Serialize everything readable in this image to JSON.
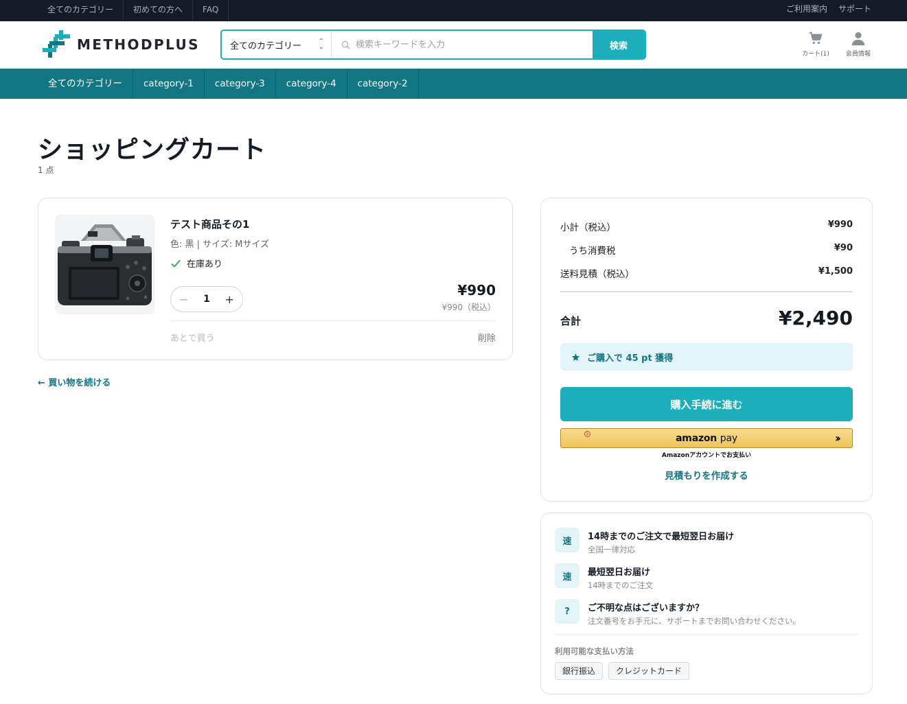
{
  "topbar": {
    "left_links": [
      "全てのカテゴリー",
      "初めての方へ",
      "FAQ"
    ],
    "right_links": [
      "ご利用案内",
      "サポート"
    ]
  },
  "header": {
    "logo_text": "METHODPLUS",
    "search": {
      "category_selected": "全てのカテゴリー",
      "placeholder": "検索キーワードを入力",
      "button_label": "検索"
    },
    "cart_label": "カート(1)",
    "account_label": "会員情報"
  },
  "category_nav": [
    "全てのカテゴリー",
    "category-1",
    "category-3",
    "category-4",
    "category-2"
  ],
  "page": {
    "title": "ショッピングカート",
    "count": "1 点"
  },
  "cart_item": {
    "name": "テスト商品その1",
    "options": "色: 黒 | サイズ: Mサイズ",
    "stock": "在庫あり",
    "quantity": "1",
    "price": "¥990",
    "price_tax": "¥990（税込）",
    "save_later": "あとで買う",
    "delete": "削除"
  },
  "continue_shopping": "← 買い物を続ける",
  "summary": {
    "subtotal_label": "小計（税込）",
    "subtotal_value": "¥990",
    "tax_label": "うち消費税",
    "tax_value": "¥90",
    "shipping_label": "送料見積（税込）",
    "shipping_value": "¥1,500",
    "total_label": "合計",
    "total_value": "¥2,490",
    "points": "ご購入で 45 pt 獲得",
    "checkout_label": "購入手続に進む",
    "amazon_logo": "amazon",
    "amazon_pay": "pay",
    "amazon_sub": "Amazonアカウントでお支払い",
    "quote_label": "見積もりを作成する"
  },
  "info": {
    "items": [
      {
        "icon": "速",
        "title": "14時までのご注文で最短翌日お届け",
        "sub": "全国一律対応"
      },
      {
        "icon": "速",
        "title": "最短翌日お届け",
        "sub": "14時までのご注文"
      },
      {
        "icon": "?",
        "title": "ご不明な点はございますか？",
        "sub": "注文番号をお手元に、サポートまでお問い合わせください。"
      }
    ],
    "payment_label": "利用可能な支払い方法",
    "payment_methods": [
      "銀行振込",
      "クレジットカード"
    ]
  },
  "colors": {
    "accent": "#1daebc",
    "nav": "#137683",
    "topbar": "#151b26"
  }
}
